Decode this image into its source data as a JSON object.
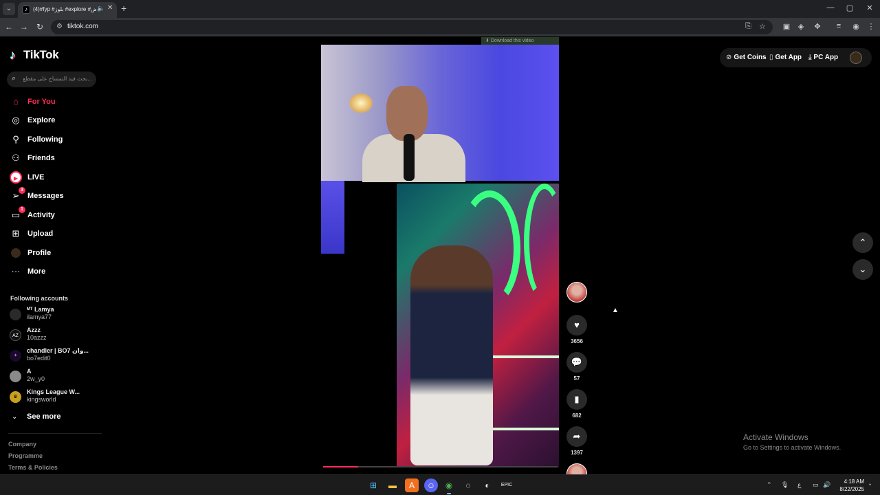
{
  "browser": {
    "tab_title": "(4)#fyp #بلوز #explore #رياض",
    "url": "tiktok.com",
    "new_tab": "+",
    "window": {
      "minimize": "—",
      "maximize": "▢",
      "close": "✕"
    }
  },
  "tiktok": {
    "logo_text": "TikTok",
    "search_placeholder": "...بحث فيد التمساح على مقطع الفارس",
    "nav": [
      {
        "label": "For You",
        "icon": "home-icon",
        "active": true
      },
      {
        "label": "Explore",
        "icon": "compass-icon"
      },
      {
        "label": "Following",
        "icon": "following-icon"
      },
      {
        "label": "Friends",
        "icon": "friends-icon"
      },
      {
        "label": "LIVE",
        "icon": "live-icon"
      },
      {
        "label": "Messages",
        "icon": "messages-icon",
        "badge": "3"
      },
      {
        "label": "Activity",
        "icon": "activity-icon",
        "badge": "1"
      },
      {
        "label": "Upload",
        "icon": "upload-icon"
      },
      {
        "label": "Profile",
        "icon": "profile-avatar"
      },
      {
        "label": "More",
        "icon": "more-icon"
      }
    ],
    "following_title": "Following accounts",
    "following_accounts": [
      {
        "name": "ᴹᵀ Lamya",
        "handle": "ilamya77"
      },
      {
        "name": "Azzz",
        "handle": "10azzz"
      },
      {
        "name": "chandler | BO7 وان...",
        "handle": "bo7edit0"
      },
      {
        "name": "A",
        "handle": "2w_y0"
      },
      {
        "name": "Kings League W...",
        "handle": "kingsworld"
      }
    ],
    "see_more": "See more",
    "footer": [
      "Company",
      "Programme",
      "Terms & Policies"
    ],
    "header": {
      "coins": "Get Coins",
      "app": "Get App",
      "pc_app": "PC App"
    },
    "download_bar": "Download this video",
    "progress": 0.15,
    "actions": {
      "likes": "3656",
      "comments": "57",
      "saves": "682",
      "shares": "1397"
    }
  },
  "os": {
    "activate_title": "Activate Windows",
    "activate_sub": "Go to Settings to activate Windows.",
    "clock_time": "4:18 AM",
    "clock_date": "8/22/2025",
    "tray_lang": "ع",
    "accent": "#fe2c55"
  }
}
